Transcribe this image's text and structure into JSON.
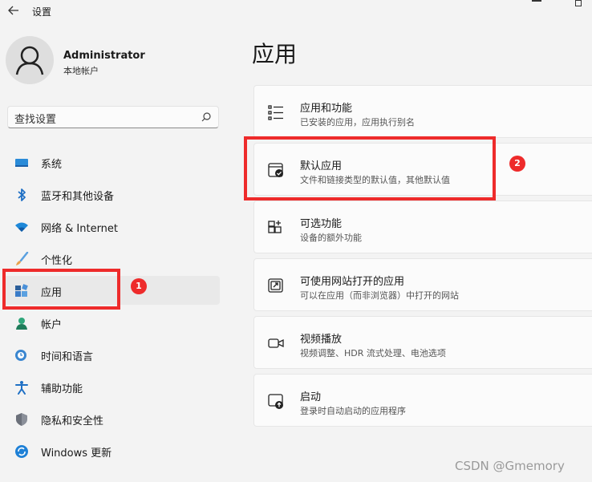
{
  "window": {
    "title": "设置"
  },
  "user": {
    "name": "Administrator",
    "account_type": "本地帐户"
  },
  "search": {
    "placeholder": "查找设置"
  },
  "sidebar": {
    "items": [
      {
        "label": "系统",
        "icon": "monitor-icon"
      },
      {
        "label": "蓝牙和其他设备",
        "icon": "bluetooth-icon"
      },
      {
        "label": "网络 & Internet",
        "icon": "wifi-icon"
      },
      {
        "label": "个性化",
        "icon": "brush-icon"
      },
      {
        "label": "应用",
        "icon": "apps-icon",
        "active": true
      },
      {
        "label": "帐户",
        "icon": "person-icon"
      },
      {
        "label": "时间和语言",
        "icon": "clock-globe-icon"
      },
      {
        "label": "辅助功能",
        "icon": "accessibility-icon"
      },
      {
        "label": "隐私和安全性",
        "icon": "shield-icon"
      },
      {
        "label": "Windows 更新",
        "icon": "update-icon"
      }
    ]
  },
  "main": {
    "title": "应用",
    "cards": [
      {
        "title": "应用和功能",
        "subtitle": "已安装的应用，应用执行别名",
        "icon": "list-icon"
      },
      {
        "title": "默认应用",
        "subtitle": "文件和链接类型的默认值，其他默认值",
        "icon": "default-app-icon"
      },
      {
        "title": "可选功能",
        "subtitle": "设备的额外功能",
        "icon": "add-grid-icon"
      },
      {
        "title": "可使用网站打开的应用",
        "subtitle": "可以在应用（而非浏览器）中打开的网站",
        "icon": "open-external-icon"
      },
      {
        "title": "视频播放",
        "subtitle": "视频调整、HDR 流式处理、电池选项",
        "icon": "video-icon"
      },
      {
        "title": "启动",
        "subtitle": "登录时自动启动的应用程序",
        "icon": "startup-icon"
      }
    ]
  },
  "annotations": {
    "badge1": "1",
    "badge2": "2",
    "color": "#ee2b2b"
  },
  "watermark": "CSDN @Gmemory"
}
